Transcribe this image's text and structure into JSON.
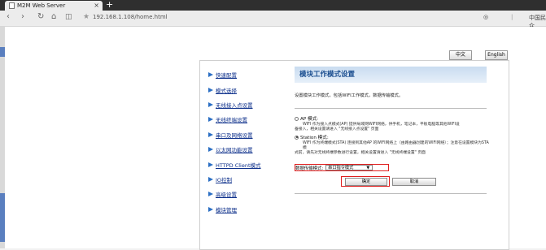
{
  "browser": {
    "tab_title": "M2M Web Server",
    "new_tab": "+",
    "url": "192.168.1.108/home.html",
    "right_text": "中国民众"
  },
  "lang": {
    "chinese": "中文",
    "english": "English"
  },
  "menu": [
    {
      "label": "快速配置"
    },
    {
      "label": "模式选择"
    },
    {
      "label": "无线接入点设置"
    },
    {
      "label": "无线终端设置"
    },
    {
      "label": "串口及网络设置"
    },
    {
      "label": "以太网功能设置"
    },
    {
      "label": "HTTPD Client模式"
    },
    {
      "label": "IO控制"
    },
    {
      "label": "高级设置"
    },
    {
      "label": "模块管理"
    }
  ],
  "main": {
    "title": "模块工作模式设置",
    "desc": "设置模块工作模式，包括WIFI工作模式，数据传输模式。",
    "ap": {
      "label": "AP 模式:",
      "desc1": "WIFI 作为接入点模式(AP) 提供局域网WIFI网络，供手机，笔记本，平板电脑等其他WIFI设",
      "desc2": "备接入，相关设置请进入 \"无线接入点设置\" 页面"
    },
    "station": {
      "label": "Station 模式:",
      "desc1": "WIFI 作为终端模式(STA) 连接到其他AP 的WIFI网络上（由路由器创建的WIFI网络）；注意在设置模块为STA模",
      "desc2": "式前，请先对无线终端参数进行设置，相关设置请进入 \"无线终端设置\" 页面"
    },
    "transfer_label": "数据传输模式:",
    "transfer_value": "串口指令模式",
    "ok": "确定",
    "cancel": "取消"
  }
}
